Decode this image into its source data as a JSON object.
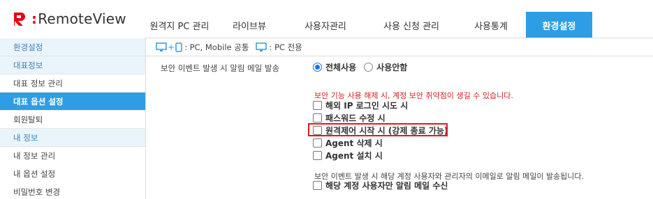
{
  "logo": {
    "brand": "RemoteView",
    "colon": ":"
  },
  "nav": {
    "tabs": [
      {
        "label": "원격지 PC 관리",
        "active": false
      },
      {
        "label": "라이브뷰",
        "active": false
      },
      {
        "label": "사용자관리",
        "active": false
      },
      {
        "label": "사용 신청 관리",
        "active": false
      },
      {
        "label": "사용통계",
        "active": false
      },
      {
        "label": "환경설정",
        "active": true
      }
    ]
  },
  "sidebar": {
    "items": [
      {
        "label": "환경설정",
        "type": "section"
      },
      {
        "label": "대표정보",
        "type": "section"
      },
      {
        "label": "대표 정보 관리",
        "type": "item"
      },
      {
        "label": "대표 옵션 설정",
        "type": "active"
      },
      {
        "label": "회원탈퇴",
        "type": "item"
      },
      {
        "label": "내 정보",
        "type": "section"
      },
      {
        "label": "내 정보 관리",
        "type": "plain"
      },
      {
        "label": "내 옵션 설정",
        "type": "plain"
      },
      {
        "label": "비밀번호 변경",
        "type": "plain"
      }
    ]
  },
  "legend": {
    "common": ": PC, Mobile 공통",
    "pc_only": ": PC 전용"
  },
  "setting": {
    "label": "보안 이벤트 발생 시 알림 메일 발송",
    "radio_all": "전체사용",
    "radio_none": "사용안함",
    "selected": "전체사용"
  },
  "warning": "보안 기능 사용 해제 시, 계정 보안 취약점이 생길 수 있습니다.",
  "events": [
    {
      "label": "해외 IP 로그인 시도 시",
      "checked": false
    },
    {
      "label": "패스워드 수정 시",
      "checked": false
    },
    {
      "label": "원격제어 시작 시 (강제 종료 가능)",
      "checked": false
    },
    {
      "label": "Agent 삭제 시",
      "checked": false
    },
    {
      "label": "Agent 설치 시",
      "checked": false
    }
  ],
  "notice": "보안 이벤트 발생 시 해당 계정 사용자와 관리자의 이메일로 알림 메일이 발송됩니다.",
  "user_only": {
    "label": "해당 계정 사용자만 알림 메일 수신",
    "checked": false
  },
  "colors": {
    "accent": "#2d9ee6",
    "brand_red": "#e60012",
    "warning": "#d21f1f",
    "highlight": "#e0181f"
  }
}
